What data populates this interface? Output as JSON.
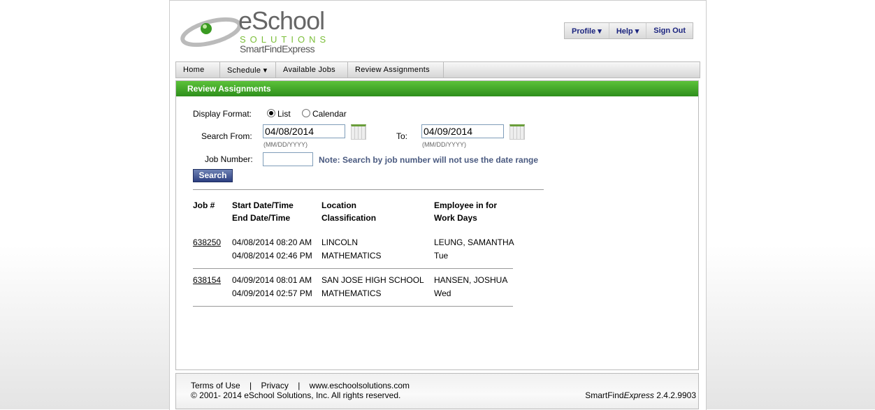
{
  "logo": {
    "brand": "eSchool",
    "sub": "SOLUTIONS",
    "product": "SmartFindExpress"
  },
  "topmenu": {
    "profile": "Profile ▾",
    "help": "Help ▾",
    "signout": "Sign Out"
  },
  "nav": [
    "Home",
    "Schedule ▾",
    "Available Jobs",
    "Review Assignments"
  ],
  "section_title": "Review Assignments",
  "form": {
    "display_label": "Display Format:",
    "list": "List",
    "calendar": "Calendar",
    "from_label": "Search From:",
    "from_value": "04/08/2014",
    "to_label": "To:",
    "to_value": "04/09/2014",
    "date_hint": "(MM/DD/YYYY)",
    "job_label": "Job Number:",
    "job_value": "",
    "note": "Note: Search by job number will not use the date range",
    "search": "Search"
  },
  "table": {
    "headers": [
      [
        "Job #",
        ""
      ],
      [
        "Start Date/Time",
        "End Date/Time"
      ],
      [
        "Location",
        "Classification"
      ],
      [
        "Employee in for",
        "Work Days"
      ]
    ],
    "rows": [
      {
        "job": "638250",
        "start": "04/08/2014 08:20 AM",
        "end": "04/08/2014 02:46 PM",
        "location": "LINCOLN",
        "class": "MATHEMATICS",
        "employee": "LEUNG, SAMANTHA",
        "days": "Tue"
      },
      {
        "job": "638154",
        "start": "04/09/2014 08:01 AM",
        "end": "04/09/2014 02:57 PM",
        "location": "SAN JOSE HIGH SCHOOL",
        "class": "MATHEMATICS",
        "employee": "HANSEN, JOSHUA",
        "days": "Wed"
      }
    ]
  },
  "footer": {
    "terms": "Terms of Use",
    "privacy": "Privacy",
    "site": "www.eschoolsolutions.com",
    "sep": "|",
    "copyright": "© 2001- 2014 eSchool Solutions, Inc. All rights reserved.",
    "version_name": "SmartFind",
    "version_italic": "Express",
    "version": "2.4.2.9903"
  }
}
